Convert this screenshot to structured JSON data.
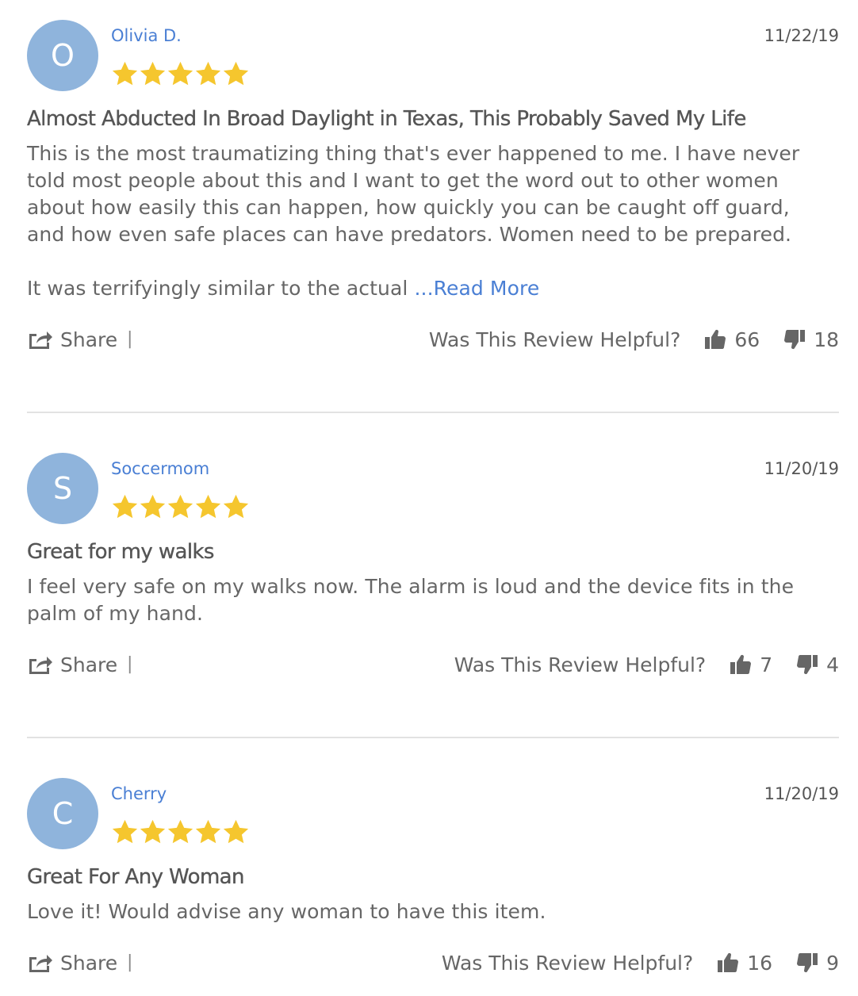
{
  "colors": {
    "avatar_bg": "#8fb4dc",
    "name_link": "#4a7fd4",
    "star": "#f5c62e",
    "text": "#666666"
  },
  "reviews": [
    {
      "avatar_initial": "O",
      "name": "Olivia D.",
      "rating": 5,
      "date": "11/22/19",
      "title": "Almost Abducted In Broad Daylight in Texas, This Probably Saved My Life",
      "body_p1": "This is the most traumatizing thing that's ever happened to me. I have never told most people about this and I want to get the word out to other women about how easily this can happen, how quickly you can be caught off guard, and how even safe places can have predators. Women need to be prepared.",
      "body_p2": "It was terrifyingly similar to the actual ",
      "read_more": "...Read More",
      "share_label": "Share",
      "share_separator": "|",
      "helpful_label": "Was This Review Helpful?",
      "helpful_up": "66",
      "helpful_down": "18"
    },
    {
      "avatar_initial": "S",
      "name": "Soccermom",
      "rating": 5,
      "date": "11/20/19",
      "title": "Great for my walks",
      "body_p1": "I feel very safe on my walks now. The alarm is loud and the device fits in the palm of my hand.",
      "share_label": "Share",
      "share_separator": "|",
      "helpful_label": "Was This Review Helpful?",
      "helpful_up": "7",
      "helpful_down": "4"
    },
    {
      "avatar_initial": "C",
      "name": "Cherry",
      "rating": 5,
      "date": "11/20/19",
      "title": "Great For Any Woman",
      "body_p1": "Love it! Would advise any woman to have this item.",
      "share_label": "Share",
      "share_separator": "|",
      "helpful_label": "Was This Review Helpful?",
      "helpful_up": "16",
      "helpful_down": "9"
    }
  ],
  "icons": {
    "star": "star-icon",
    "share": "share-icon",
    "thumbs_up": "thumbs-up-icon",
    "thumbs_down": "thumbs-down-icon"
  }
}
